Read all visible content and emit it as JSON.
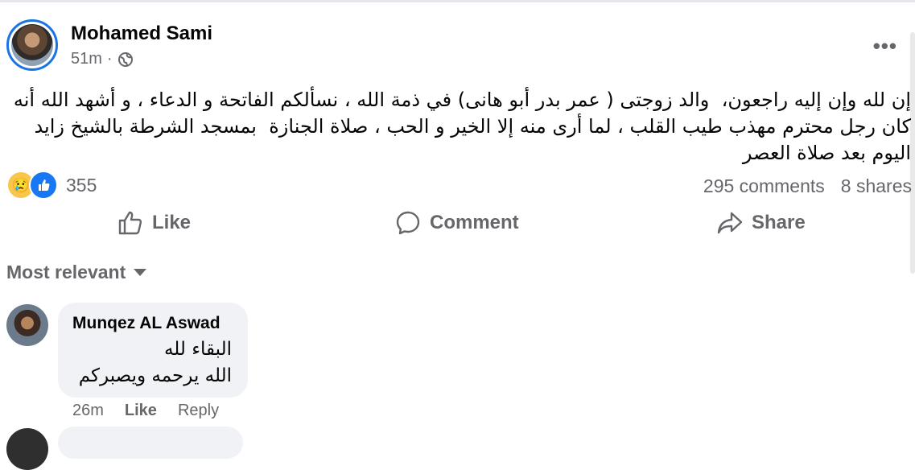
{
  "post": {
    "author": "Mohamed Sami",
    "time": "51m",
    "separator": "·",
    "more": "•••",
    "text": "إن لله وإن إليه راجعون،  والد زوجتى ( عمر بدر أبو هانى) في ذمة الله ، نسألكم الفاتحة و الدعاء ، و أشهد الله أنه كان رجل محترم مهذب طيب القلب ، لما أرى منه إلا الخير و الحب ، صلاة الجنازة  بمسجد الشرطة بالشيخ زايد اليوم بعد صلاة العصر",
    "reaction_icons": [
      "sad-emoji-icon",
      "like-thumb-icon"
    ],
    "reaction_count": "355",
    "comments_count": "295 comments",
    "shares_count": "8 shares"
  },
  "actions": {
    "like": "Like",
    "comment": "Comment",
    "share": "Share"
  },
  "comments_section": {
    "sort_label": "Most relevant",
    "comments": [
      {
        "author": "Munqez AL Aswad",
        "text": "البقاء لله\nالله يرحمه ويصبركم",
        "time": "26m",
        "like": "Like",
        "reply": "Reply"
      }
    ]
  },
  "colors": {
    "accent": "#1b74e4",
    "secondary_text": "#65676b",
    "bubble": "#f0f2f5"
  }
}
